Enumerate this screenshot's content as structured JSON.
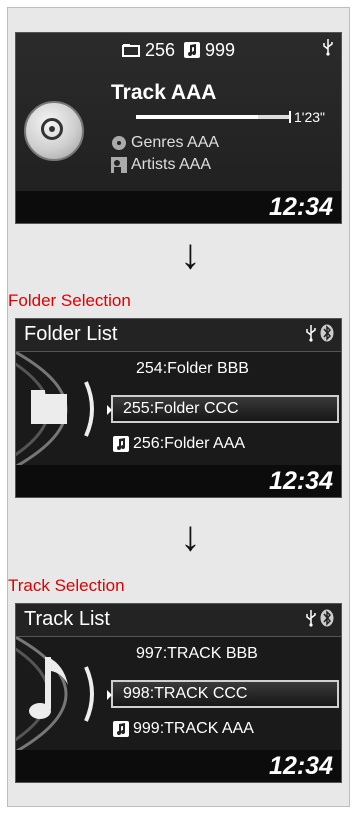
{
  "now_playing": {
    "folder_count": "256",
    "track_count": "999",
    "track_title": "Track AAA",
    "elapsed_time": "1'23\"",
    "progress": 0.8,
    "genre": "Genres AAA",
    "artist": "Artists AAA",
    "clock": "12:34"
  },
  "arrows": [
    "↓",
    "↓"
  ],
  "folder_section": {
    "label": "Folder Selection",
    "title": "Folder List",
    "items": [
      "254:Folder BBB",
      "255:Folder CCC",
      "256:Folder AAA"
    ],
    "selected_index": 1,
    "clock": "12:34"
  },
  "track_section": {
    "label": "Track Selection",
    "title": "Track List",
    "items": [
      "997:TRACK BBB",
      "998:TRACK CCC",
      "999:TRACK AAA"
    ],
    "selected_index": 1,
    "clock": "12:34"
  },
  "icons": {
    "usb": "usb-icon",
    "bluetooth": "bluetooth-icon",
    "folder": "folder-icon",
    "music_note": "music-note-icon",
    "track": "track-icon",
    "genre": "genre-icon",
    "artist": "artist-icon",
    "disc": "disc-icon"
  }
}
